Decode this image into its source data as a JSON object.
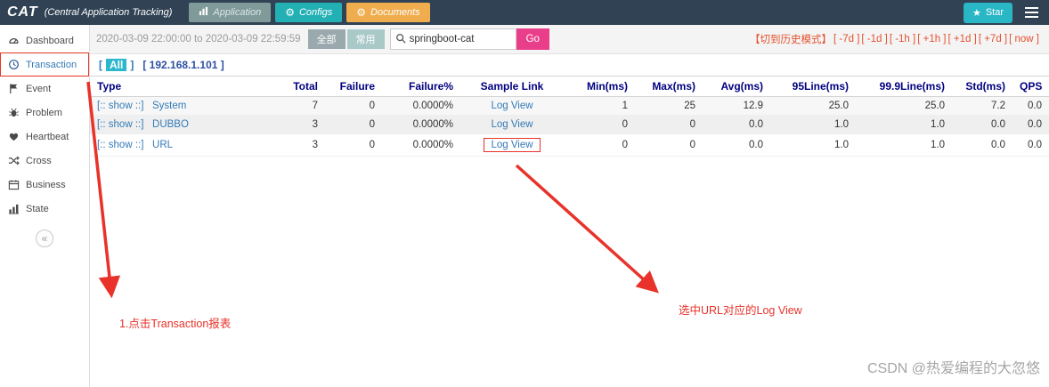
{
  "topbar": {
    "logo": "CAT",
    "subtitle": "(Central Application Tracking)",
    "application_label": "Application",
    "configs_label": "Configs",
    "documents_label": "Documents",
    "star_label": "Star"
  },
  "icons": {
    "star": "★",
    "gear": "⚙",
    "collapse": "«"
  },
  "sidebar": {
    "items": [
      {
        "label": "Dashboard"
      },
      {
        "label": "Transaction"
      },
      {
        "label": "Event"
      },
      {
        "label": "Problem"
      },
      {
        "label": "Heartbeat"
      },
      {
        "label": "Cross"
      },
      {
        "label": "Business"
      },
      {
        "label": "State"
      }
    ]
  },
  "filterbar": {
    "date_range": "2020-03-09 22:00:00 to 2020-03-09 22:59:59",
    "all_button": "全部",
    "common_button": "常用",
    "search_value": "springboot-cat",
    "go_button": "Go",
    "history_mode_link": "【切到历史模式】",
    "time_links": [
      "[ -7d ]",
      "[ -1d ]",
      "[ -1h ]",
      "[ +1h ]",
      "[ +1d ]",
      "[ +7d ]",
      "[ now ]"
    ]
  },
  "machine_bar": {
    "bracket_open": "[",
    "all_label": "All",
    "bracket_close": "]",
    "ip_link": "[ 192.168.1.101 ]"
  },
  "table": {
    "headers": [
      "Type",
      "Total",
      "Failure",
      "Failure%",
      "Sample Link",
      "Min(ms)",
      "Max(ms)",
      "Avg(ms)",
      "95Line(ms)",
      "99.9Line(ms)",
      "Std(ms)",
      "QPS"
    ],
    "rows": [
      {
        "show_link": "[:: show ::]",
        "type": "System",
        "total": "7",
        "failure": "0",
        "failure_pct": "0.0000%",
        "sample_link": "Log View",
        "min": "1",
        "max": "25",
        "avg": "12.9",
        "p95": "25.0",
        "p999": "25.0",
        "std": "7.2",
        "qps": "0.0"
      },
      {
        "show_link": "[:: show ::]",
        "type": "DUBBO",
        "total": "3",
        "failure": "0",
        "failure_pct": "0.0000%",
        "sample_link": "Log View",
        "min": "0",
        "max": "0",
        "avg": "0.0",
        "p95": "1.0",
        "p999": "1.0",
        "std": "0.0",
        "qps": "0.0"
      },
      {
        "show_link": "[:: show ::]",
        "type": "URL",
        "total": "3",
        "failure": "0",
        "failure_pct": "0.0000%",
        "sample_link": "Log View",
        "min": "0",
        "max": "0",
        "avg": "0.0",
        "p95": "1.0",
        "p999": "1.0",
        "std": "0.0",
        "qps": "0.0"
      }
    ]
  },
  "annotations": {
    "step1_note": "1.点击Transaction报表",
    "step2_note": "选中URL对应的Log View"
  },
  "watermark": "CSDN @热爱编程的大忽悠",
  "colors": {
    "topbar_bg": "#304254",
    "configs_btn": "#23b0b4",
    "documents_btn": "#f0ad4e",
    "star_btn": "#29b6c5",
    "go_btn": "#e93f8a",
    "link_blue": "#337ab7",
    "header_navy": "#000080",
    "annotation_red": "#e8322a",
    "all_badge_bg": "#2bb8cc"
  }
}
